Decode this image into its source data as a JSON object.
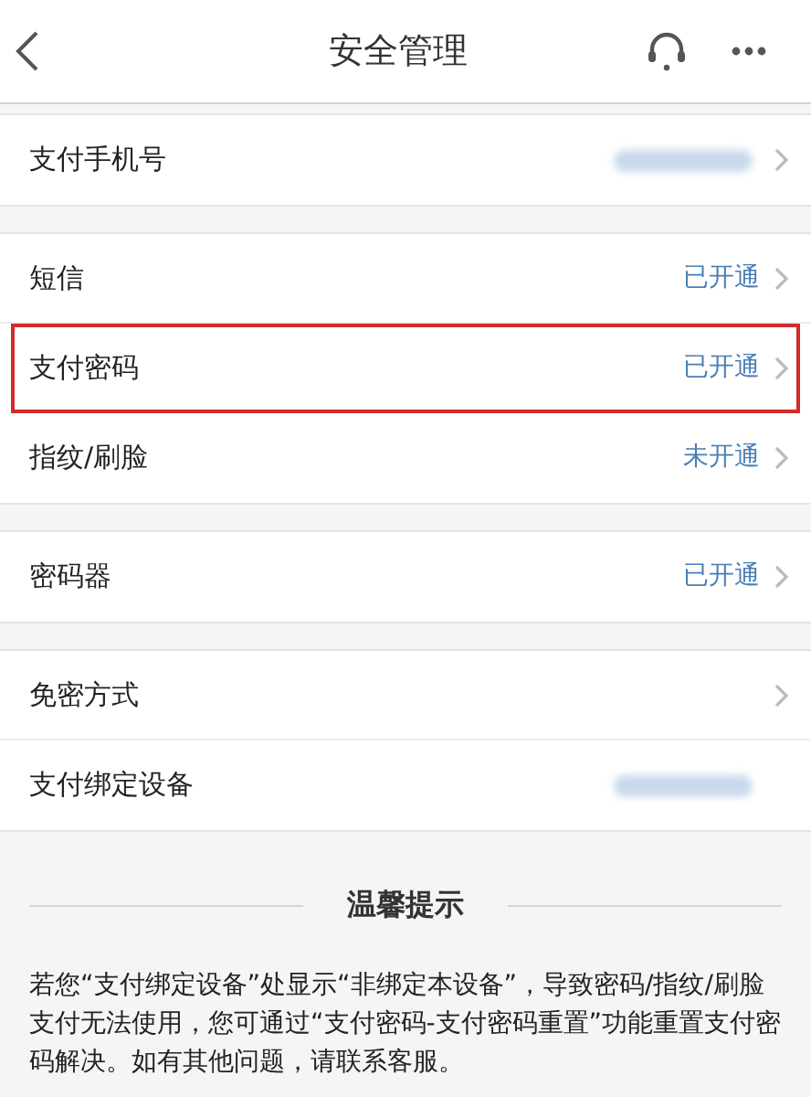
{
  "header": {
    "title": "安全管理"
  },
  "sections": [
    {
      "rows": [
        {
          "label": "支付手机号",
          "value_blurred": true,
          "chevron": true,
          "highlighted": false
        }
      ]
    },
    {
      "rows": [
        {
          "label": "短信",
          "value": "已开通",
          "chevron": true,
          "highlighted": false
        },
        {
          "label": "支付密码",
          "value": "已开通",
          "chevron": true,
          "highlighted": true
        },
        {
          "label": "指纹/刷脸",
          "value": "未开通",
          "chevron": true,
          "highlighted": false
        }
      ]
    },
    {
      "rows": [
        {
          "label": "密码器",
          "value": "已开通",
          "chevron": true,
          "highlighted": false
        }
      ]
    },
    {
      "rows": [
        {
          "label": "免密方式",
          "chevron": true,
          "highlighted": false
        },
        {
          "label": "支付绑定设备",
          "value_blurred": true,
          "chevron": false,
          "highlighted": false
        }
      ]
    }
  ],
  "tips": {
    "heading": "温馨提示",
    "text": "若您“支付绑定设备”处显示“非绑定本设备”，导致密码/指纹/刷脸支付无法使用，您可通过“支付密码-支付密码重置”功能重置支付密码解决。如有其他问题，请联系客服。"
  }
}
